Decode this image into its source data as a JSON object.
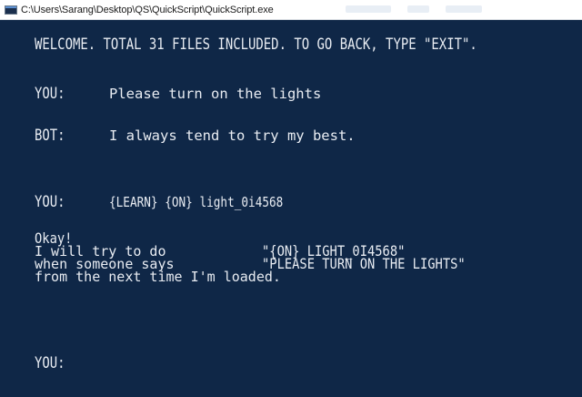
{
  "window": {
    "title": "C:\\Users\\Sarang\\Desktop\\QS\\QuickScript\\QuickScript.exe",
    "icon": "console-window-icon"
  },
  "console": {
    "welcome": "WELCOME. TOTAL 31 FILES INCLUDED. TO GO BACK, TYPE \"EXIT\".",
    "exchanges": [
      {
        "speaker": "YOU:",
        "message": "Please turn on the lights"
      },
      {
        "speaker": "BOT:",
        "message": "I always tend to try my best."
      },
      {
        "speaker": "YOU:",
        "message": "{LEARN} {ON} light_0i4568"
      }
    ],
    "learn_response": {
      "okay": "Okay!",
      "row1_label": "I will try to do",
      "row1_value": "\"{ON} LIGHT_0I4568\"",
      "row2_label": "when someone says",
      "row2_value": "\"PLEASE TURN ON THE LIGHTS\"",
      "row3_label": "from the next time I'm loaded."
    },
    "prompt": "YOU:"
  },
  "colors": {
    "console_background": "#0f2747",
    "console_text": "#e8ecf2"
  }
}
